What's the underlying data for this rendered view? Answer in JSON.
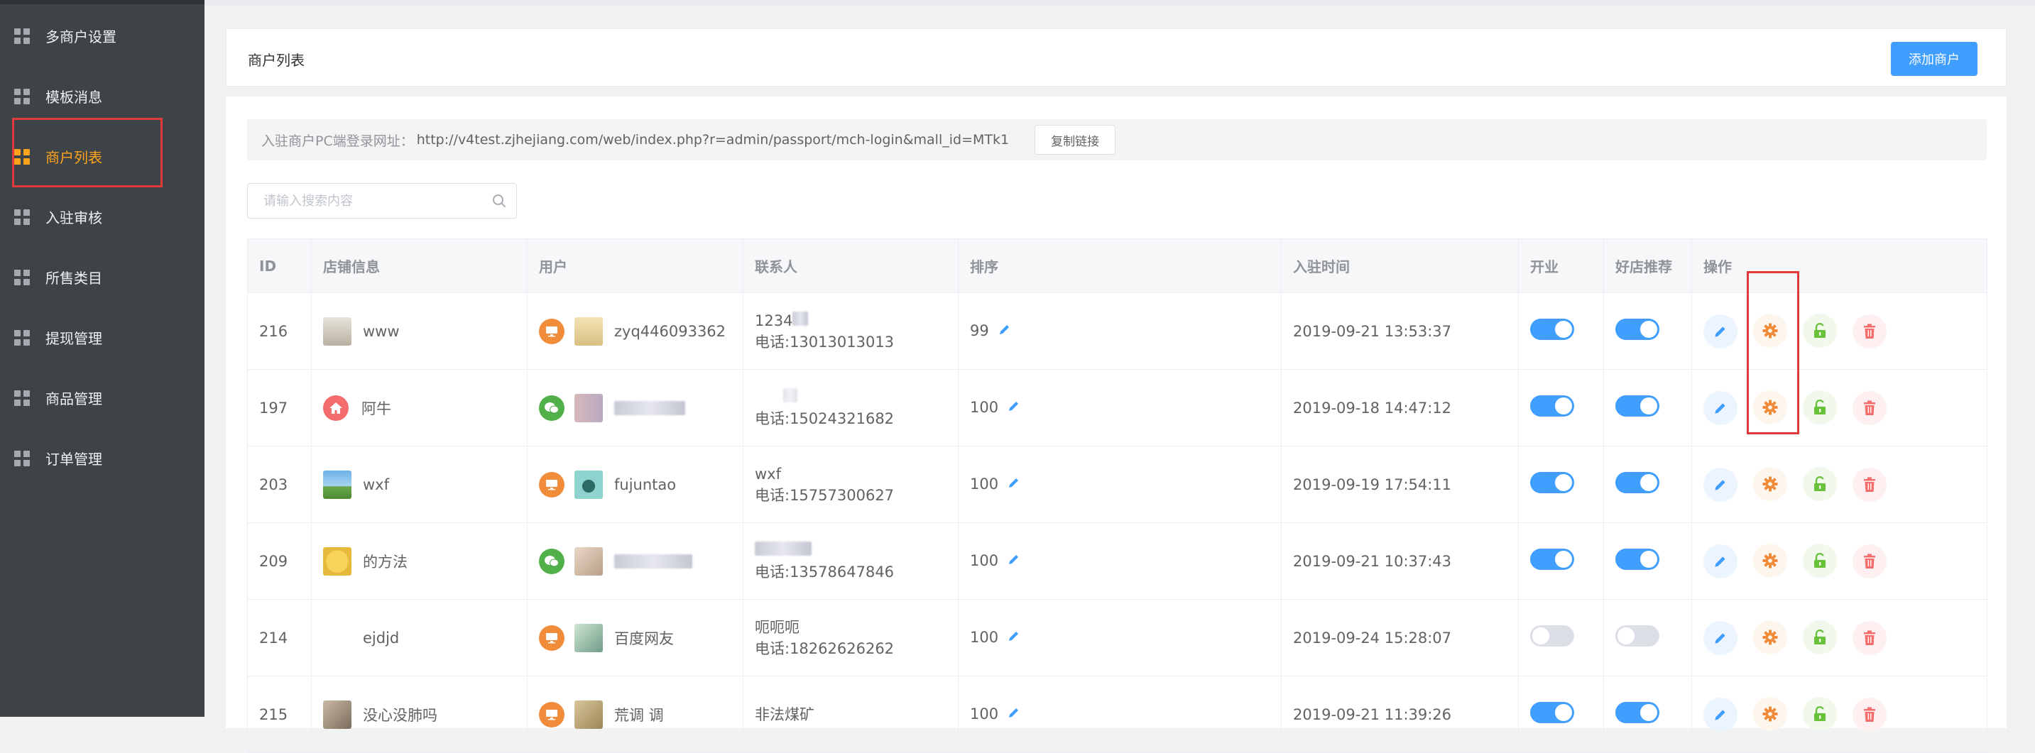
{
  "sidebar": {
    "items": [
      {
        "label": "多商户设置"
      },
      {
        "label": "模板消息"
      },
      {
        "label": "商户列表",
        "active": true
      },
      {
        "label": "入驻审核"
      },
      {
        "label": "所售类目"
      },
      {
        "label": "提现管理"
      },
      {
        "label": "商品管理"
      },
      {
        "label": "订单管理"
      }
    ]
  },
  "header": {
    "title": "商户列表",
    "add_button": "添加商户"
  },
  "url_bar": {
    "label": "入驻商户PC端登录网址：",
    "url": "http://v4test.zjhejiang.com/web/index.php?r=admin/passport/mch-login&mall_id=MTk1",
    "copy_button": "复制链接"
  },
  "search": {
    "placeholder": "请输入搜索内容",
    "value": ""
  },
  "table": {
    "columns": [
      "ID",
      "店铺信息",
      "用户",
      "联系人",
      "排序",
      "入驻时间",
      "开业",
      "好店推荐",
      "操作"
    ],
    "rows": [
      {
        "id": "216",
        "store": "www",
        "store_icon": "building",
        "platform": "pc",
        "user": "zyq446093362",
        "contact_name": "1234",
        "phone": "电话:13013013013",
        "sort": "99",
        "time": "2019-09-21 13:53:37",
        "open": true,
        "recommend": true
      },
      {
        "id": "197",
        "store": "阿牛",
        "store_icon": "home",
        "platform": "wechat",
        "user": "",
        "contact_name": "",
        "phone": "电话:15024321682",
        "sort": "100",
        "time": "2019-09-18 14:47:12",
        "open": true,
        "recommend": true
      },
      {
        "id": "203",
        "store": "wxf",
        "store_icon": "landscape",
        "platform": "pc",
        "user": "fujuntao",
        "contact_name": "wxf",
        "phone": "电话:15757300627",
        "sort": "100",
        "time": "2019-09-19 17:54:11",
        "open": true,
        "recommend": true
      },
      {
        "id": "209",
        "store": "的方法",
        "store_icon": "emoji",
        "platform": "wechat",
        "user": "",
        "contact_name": "",
        "phone": "电话:13578647846",
        "sort": "100",
        "time": "2019-09-21 10:37:43",
        "open": true,
        "recommend": true
      },
      {
        "id": "214",
        "store": "ejdjd",
        "store_icon": "",
        "platform": "pc",
        "user": "百度网友",
        "contact_name": "呃呃呃",
        "phone": "电话:18262626262",
        "sort": "100",
        "time": "2019-09-24 15:28:07",
        "open": false,
        "recommend": false
      },
      {
        "id": "215",
        "store": "没心没肺吗",
        "store_icon": "photo",
        "platform": "pc",
        "user": "荒调 调",
        "contact_name": "非法煤矿",
        "phone": "",
        "sort": "100",
        "time": "2019-09-21 11:39:26",
        "open": true,
        "recommend": true
      }
    ]
  },
  "colors": {
    "sidebar_bg": "#3e4348",
    "active": "#ffa41c",
    "primary": "#409eff",
    "highlight_box": "#e03a3a"
  }
}
